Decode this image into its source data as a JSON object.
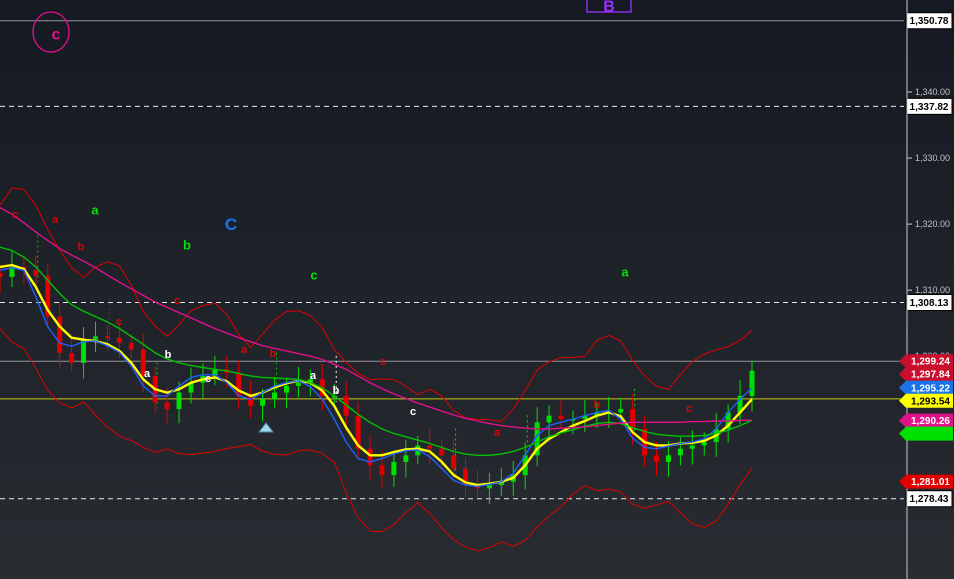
{
  "chart_data": {
    "type": "candlestick",
    "price_axis": {
      "range": [
        1274.0,
        1351.8
      ],
      "ticks": [
        "1,340.00",
        "1,330.00",
        "1,320.00",
        "1,310.00",
        "1,300.00"
      ]
    },
    "horizontal_lines": [
      {
        "price": 1350.78,
        "label": "1,350.78",
        "style": "solid",
        "color": "#b9bcc2"
      },
      {
        "price": 1337.82,
        "label": "1,337.82",
        "style": "dashed",
        "color": "#ffffff"
      },
      {
        "price": 1308.13,
        "label": "1,308.13",
        "style": "dashed",
        "color": "#ffffff"
      },
      {
        "price": 1299.24,
        "label": "",
        "style": "solid",
        "color": "#b9bcc2"
      },
      {
        "price": 1293.54,
        "label": "1,293.54",
        "style": "solid",
        "color": "#ffff00"
      },
      {
        "price": 1278.43,
        "label": "1,278.43",
        "style": "dashed",
        "color": "#ffffff"
      }
    ],
    "price_badges": [
      {
        "price": 1299.24,
        "label": "1,299.24",
        "color": "#c8102e",
        "text_color": "#ffffff"
      },
      {
        "price": 1297.84,
        "label": "1,297.84",
        "color": "#c8102e",
        "text_color": "#ffffff"
      },
      {
        "price": 1295.22,
        "label": "1,295.22",
        "color": "#1a73e8",
        "text_color": "#ffffff"
      },
      {
        "price": 1293.54,
        "label": "1,293.54",
        "color": "#ffff00",
        "text_color": "#000000"
      },
      {
        "price": 1290.26,
        "label": "1,290.26",
        "color": "#e0118a",
        "text_color": "#ffffff"
      },
      {
        "price": 1289.2,
        "label": "",
        "color": "#00e000",
        "text_color": "#000000"
      },
      {
        "price": 1281.01,
        "label": "1,281.01",
        "color": "#e00000",
        "text_color": "#ffffff"
      }
    ],
    "closes": [
      1312.0,
      1313.5,
      1313.0,
      1312.2,
      1306.0,
      1300.5,
      1299.0,
      1302.5,
      1303.0,
      1302.8,
      1302.0,
      1301.0,
      1297.0,
      1293.0,
      1292.0,
      1294.5,
      1296.0,
      1297.0,
      1298.0,
      1297.5,
      1294.0,
      1292.5,
      1293.5,
      1294.5,
      1295.5,
      1296.0,
      1296.5,
      1294.0,
      1294.0,
      1291.0,
      1286.0,
      1283.5,
      1282.0,
      1284.0,
      1285.0,
      1286.5,
      1286.0,
      1285.0,
      1283.0,
      1280.5,
      1280.0,
      1280.5,
      1281.0,
      1282.0,
      1285.0,
      1290.0,
      1291.0,
      1290.5,
      1290.5,
      1291.0,
      1291.5,
      1291.5,
      1292.0,
      1289.0,
      1285.0,
      1284.0,
      1285.0,
      1286.0,
      1286.5,
      1287.0,
      1289.0,
      1291.5,
      1294.0,
      1297.8
    ],
    "moving_averages": [
      {
        "color": "#ffff00",
        "values": [
          1313.5,
          1313.8,
          1313.2,
          1310.5,
          1307.0,
          1304.5,
          1302.8,
          1302.5,
          1302.3,
          1301.8,
          1300.8,
          1299.0,
          1296.5,
          1295.0,
          1294.5,
          1295.0,
          1296.0,
          1296.5,
          1296.8,
          1296.2,
          1294.8,
          1294.0,
          1294.5,
          1295.3,
          1295.9,
          1296.3,
          1296.0,
          1294.8,
          1292.5,
          1289.2,
          1286.5,
          1285.0,
          1285.0,
          1285.5,
          1285.9,
          1286.0,
          1285.6,
          1284.0,
          1282.0,
          1280.9,
          1280.5,
          1280.7,
          1281.0,
          1281.6,
          1283.5,
          1286.0,
          1287.5,
          1288.5,
          1289.5,
          1290.2,
          1291.0,
          1291.5,
          1290.9,
          1288.5,
          1287.0,
          1286.5,
          1286.5,
          1286.8,
          1286.9,
          1287.2,
          1288.0,
          1289.5,
          1291.5,
          1293.5
        ]
      },
      {
        "color": "#2060ff",
        "values": [
          1313.0,
          1313.4,
          1313.0,
          1309.0,
          1304.5,
          1302.0,
          1301.5,
          1302.2,
          1302.3,
          1301.6,
          1300.6,
          1298.5,
          1295.5,
          1294.0,
          1294.0,
          1295.5,
          1296.8,
          1297.2,
          1297.2,
          1296.0,
          1294.0,
          1293.5,
          1294.5,
          1295.5,
          1296.0,
          1296.3,
          1295.4,
          1293.5,
          1290.5,
          1287.0,
          1284.5,
          1284.0,
          1284.5,
          1285.2,
          1285.7,
          1285.8,
          1284.8,
          1283.0,
          1281.2,
          1280.5,
          1280.3,
          1280.6,
          1281.0,
          1282.3,
          1285.0,
          1288.0,
          1289.5,
          1290.0,
          1290.5,
          1291.0,
          1291.5,
          1291.8,
          1290.5,
          1287.6,
          1286.2,
          1286.0,
          1286.4,
          1286.8,
          1287.0,
          1287.5,
          1289.0,
          1291.5,
          1293.5,
          1295.2
        ]
      },
      {
        "color": "#00c000",
        "values": [
          1316.5,
          1316.0,
          1315.0,
          1313.5,
          1311.5,
          1309.5,
          1307.8,
          1306.8,
          1306.0,
          1305.2,
          1304.2,
          1303.0,
          1301.8,
          1300.5,
          1299.6,
          1299.0,
          1298.6,
          1298.3,
          1298.0,
          1297.8,
          1297.4,
          1297.0,
          1296.8,
          1296.7,
          1296.6,
          1296.5,
          1296.0,
          1295.2,
          1294.0,
          1292.6,
          1291.2,
          1290.0,
          1289.0,
          1288.3,
          1287.8,
          1287.3,
          1286.8,
          1286.2,
          1285.6,
          1285.2,
          1285.0,
          1285.0,
          1285.2,
          1285.6,
          1286.2,
          1287.0,
          1287.8,
          1288.4,
          1288.9,
          1289.4,
          1289.8,
          1290.0,
          1289.8,
          1289.2,
          1288.6,
          1288.2,
          1288.0,
          1287.9,
          1287.9,
          1288.0,
          1288.3,
          1288.8,
          1289.5,
          1290.3
        ]
      },
      {
        "color": "#e0118a",
        "values": [
          1322.5,
          1321.5,
          1320.2,
          1318.8,
          1317.5,
          1316.3,
          1315.3,
          1314.4,
          1313.4,
          1312.3,
          1311.2,
          1310.2,
          1309.2,
          1308.2,
          1307.4,
          1306.6,
          1305.8,
          1305.0,
          1304.2,
          1303.5,
          1302.8,
          1302.2,
          1301.6,
          1301.2,
          1300.8,
          1300.4,
          1300.0,
          1299.5,
          1298.8,
          1298.0,
          1297.0,
          1296.0,
          1295.1,
          1294.3,
          1293.6,
          1292.9,
          1292.3,
          1291.7,
          1291.1,
          1290.6,
          1290.2,
          1289.8,
          1289.5,
          1289.3,
          1289.1,
          1289.0,
          1289.0,
          1289.1,
          1289.2,
          1289.3,
          1289.5,
          1289.7,
          1289.9,
          1290.0,
          1290.0,
          1290.0,
          1290.0,
          1290.0,
          1290.1,
          1290.1,
          1290.2,
          1290.2,
          1290.3,
          1290.3
        ]
      }
    ],
    "wave_labels": [
      {
        "text": "c",
        "color": "#e0118a",
        "size": "xl"
      },
      {
        "text": "B",
        "color": "#9b30ff",
        "size": "xl"
      },
      {
        "text": "C",
        "color": "#1a73e8",
        "size": "lg"
      },
      {
        "text": "a",
        "color": "#00e000",
        "size": "md"
      },
      {
        "text": "b",
        "color": "#00e000",
        "size": "md"
      },
      {
        "text": "c",
        "color": "#00e000",
        "size": "md"
      },
      {
        "text": "a",
        "color": "#00e000",
        "size": "md"
      },
      {
        "text": "c",
        "color": "#e00000",
        "size": "sm"
      },
      {
        "text": "a",
        "color": "#e00000",
        "size": "sm"
      },
      {
        "text": "b",
        "color": "#e00000",
        "size": "sm"
      },
      {
        "text": "c",
        "color": "#e00000",
        "size": "sm"
      },
      {
        "text": "c",
        "color": "#e00000",
        "size": "sm"
      },
      {
        "text": "a",
        "color": "#e00000",
        "size": "sm"
      },
      {
        "text": "b",
        "color": "#e00000",
        "size": "sm"
      },
      {
        "text": "c",
        "color": "#e00000",
        "size": "sm"
      },
      {
        "text": "a",
        "color": "#e00000",
        "size": "sm"
      },
      {
        "text": "b",
        "color": "#e00000",
        "size": "sm"
      },
      {
        "text": "c",
        "color": "#e00000",
        "size": "sm"
      },
      {
        "text": "a",
        "color": "#ffffff",
        "size": "sm"
      },
      {
        "text": "b",
        "color": "#ffffff",
        "size": "sm"
      },
      {
        "text": "c",
        "color": "#ffffff",
        "size": "sm"
      },
      {
        "text": "a",
        "color": "#ffffff",
        "size": "sm"
      },
      {
        "text": "b",
        "color": "#ffffff",
        "size": "sm"
      },
      {
        "text": "c",
        "color": "#ffffff",
        "size": "sm"
      }
    ],
    "colors": {
      "up": "#00e000",
      "down": "#e00000",
      "bands": "#e00000",
      "axis": "#bfc3c9"
    },
    "grid": false
  }
}
